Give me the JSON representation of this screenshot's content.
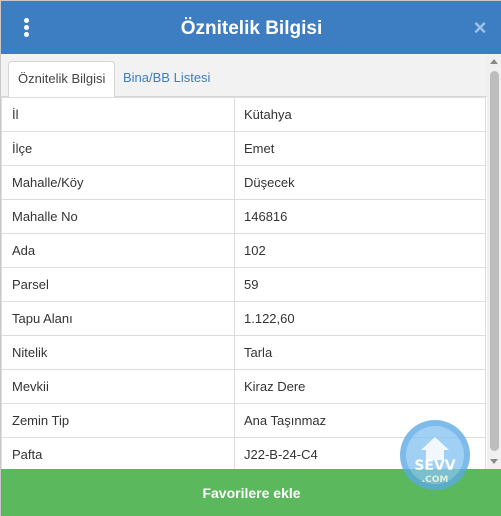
{
  "header": {
    "title": "Öznitelik Bilgisi",
    "close_label": "×"
  },
  "tabs": [
    {
      "label": "Öznitelik Bilgisi",
      "active": true
    },
    {
      "label": "Bina/BB Listesi",
      "active": false
    }
  ],
  "attributes": [
    {
      "label": "İl",
      "value": "Kütahya"
    },
    {
      "label": "İlçe",
      "value": "Emet"
    },
    {
      "label": "Mahalle/Köy",
      "value": "Düşecek"
    },
    {
      "label": "Mahalle No",
      "value": "146816"
    },
    {
      "label": "Ada",
      "value": "102"
    },
    {
      "label": "Parsel",
      "value": "59"
    },
    {
      "label": "Tapu Alanı",
      "value": "1.122,60"
    },
    {
      "label": "Nitelik",
      "value": "Tarla"
    },
    {
      "label": "Mevkii",
      "value": "Kiraz Dere"
    },
    {
      "label": "Zemin Tip",
      "value": "Ana Taşınmaz"
    },
    {
      "label": "Pafta",
      "value": "J22-B-24-C4"
    }
  ],
  "footer": {
    "button_label": "Favorilere ekle"
  },
  "watermark": {
    "text_top": "SEVV",
    "text_bottom": ".COM"
  },
  "colors": {
    "header_bg": "#3d7ec2",
    "tab_link": "#3d7ec2",
    "footer_bg": "#5cb85c"
  }
}
